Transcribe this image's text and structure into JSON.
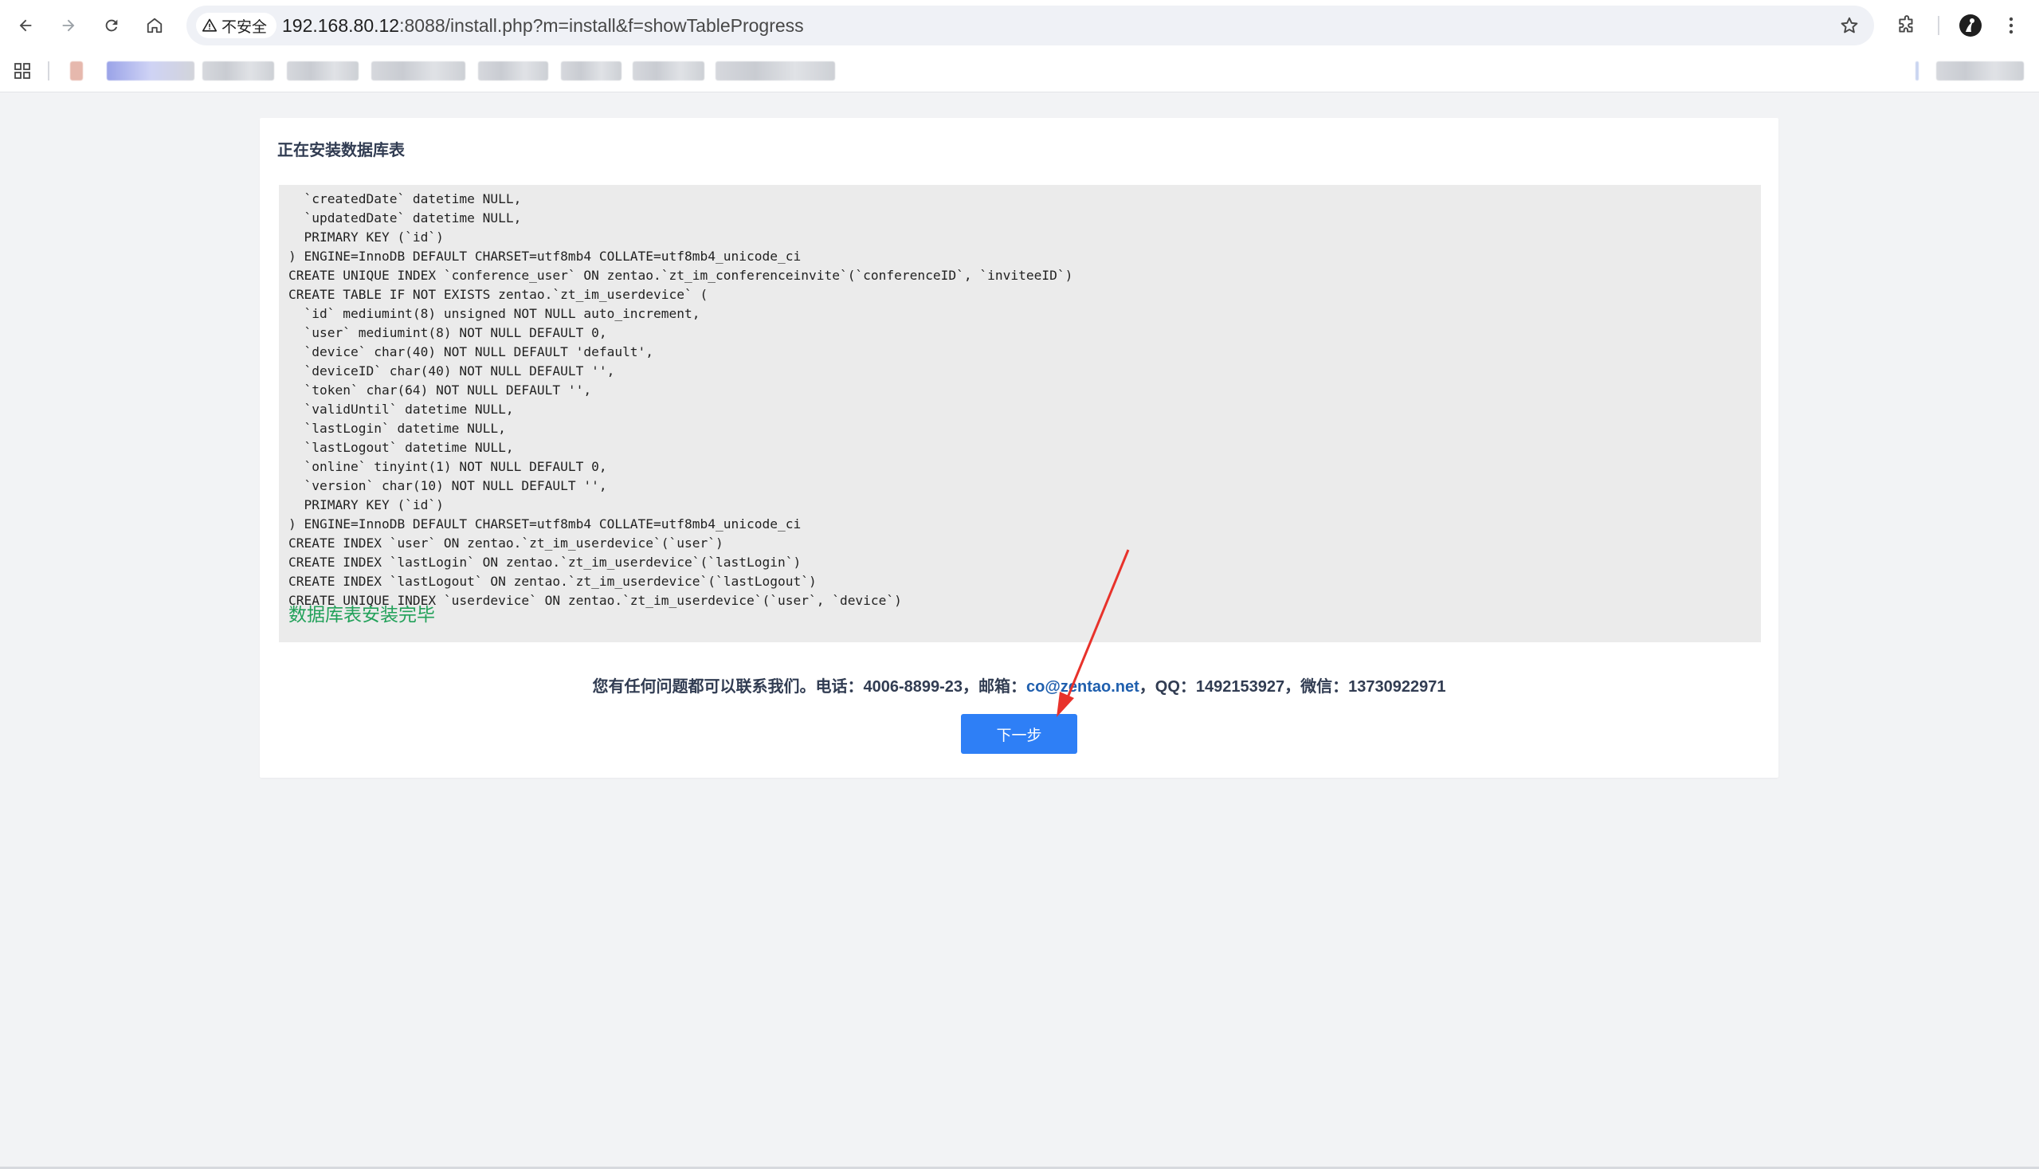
{
  "browser": {
    "security_label": "不安全",
    "url_host": "192.168.80.12",
    "url_rest": ":8088/install.php?m=install&f=showTableProgress"
  },
  "page": {
    "title": "正在安装数据库表",
    "log_lines": [
      "  `createdDate` datetime NULL,",
      "  `updatedDate` datetime NULL,",
      "  PRIMARY KEY (`id`)",
      ") ENGINE=InnoDB DEFAULT CHARSET=utf8mb4 COLLATE=utf8mb4_unicode_ci",
      "CREATE UNIQUE INDEX `conference_user` ON zentao.`zt_im_conferenceinvite`(`conferenceID`, `inviteeID`)",
      "CREATE TABLE IF NOT EXISTS zentao.`zt_im_userdevice` (",
      "  `id` mediumint(8) unsigned NOT NULL auto_increment,",
      "  `user` mediumint(8) NOT NULL DEFAULT 0,",
      "  `device` char(40) NOT NULL DEFAULT 'default',",
      "  `deviceID` char(40) NOT NULL DEFAULT '',",
      "  `token` char(64) NOT NULL DEFAULT '',",
      "  `validUntil` datetime NULL,",
      "  `lastLogin` datetime NULL,",
      "  `lastLogout` datetime NULL,",
      "  `online` tinyint(1) NOT NULL DEFAULT 0,",
      "  `version` char(10) NOT NULL DEFAULT '',",
      "  PRIMARY KEY (`id`)",
      ") ENGINE=InnoDB DEFAULT CHARSET=utf8mb4 COLLATE=utf8mb4_unicode_ci",
      "CREATE INDEX `user` ON zentao.`zt_im_userdevice`(`user`)",
      "CREATE INDEX `lastLogin` ON zentao.`zt_im_userdevice`(`lastLogin`)",
      "CREATE INDEX `lastLogout` ON zentao.`zt_im_userdevice`(`lastLogout`)",
      "CREATE UNIQUE INDEX `userdevice` ON zentao.`zt_im_userdevice`(`user`, `device`)"
    ],
    "done_message": "数据库表安装完毕",
    "contact_prefix": "您有任何问题都可以联系我们。电话：4006-8899-23，邮箱：",
    "contact_email": "co@zentao.net",
    "contact_suffix": "，QQ：1492153927，微信：13730922971",
    "next_button": "下一步"
  },
  "colors": {
    "accent": "#2e7ff6",
    "success_text": "#22a15a",
    "annotation_arrow": "#e8322b"
  }
}
